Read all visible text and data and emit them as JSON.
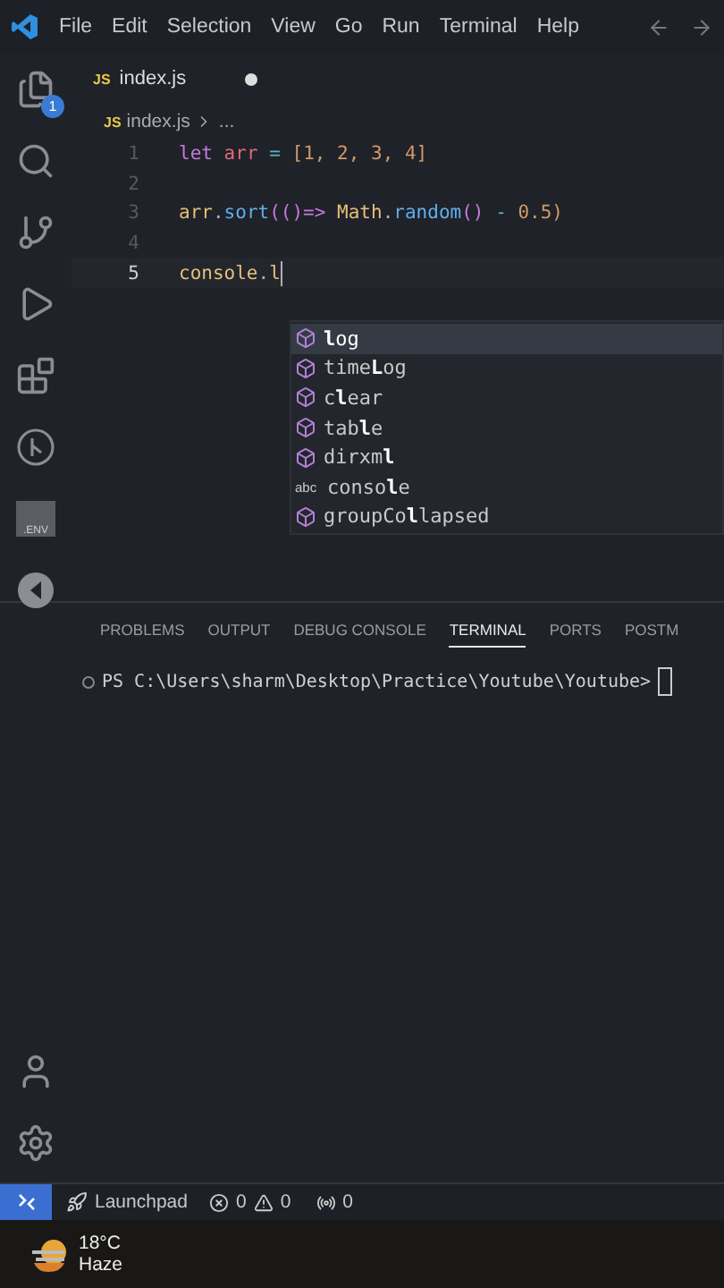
{
  "menu_bar": {
    "items": [
      "File",
      "Edit",
      "Selection",
      "View",
      "Go",
      "Run",
      "Terminal",
      "Help"
    ]
  },
  "activity_bar": {
    "explorer_badge": "1",
    "env_label": ".ENV"
  },
  "tab": {
    "label": "index.js",
    "file_type": "JS",
    "modified": true
  },
  "breadcrumb": {
    "file_type": "JS",
    "file": "index.js",
    "rest": "..."
  },
  "editor": {
    "lines": [
      {
        "number": "1",
        "current": false,
        "tokens": [
          {
            "kind": "keyword",
            "text": "let "
          },
          {
            "kind": "variable",
            "text": "arr "
          },
          {
            "kind": "operator",
            "text": "= "
          },
          {
            "kind": "number",
            "text": "[1, 2, 3, 4]"
          }
        ]
      },
      {
        "number": "2",
        "current": false
      },
      {
        "number": "3",
        "current": false,
        "tokens": [
          {
            "kind": "ident",
            "text": "arr"
          },
          {
            "kind": "punct",
            "text": "."
          },
          {
            "kind": "func",
            "text": "sort"
          },
          {
            "kind": "paren",
            "text": "(()=> "
          },
          {
            "kind": "ident",
            "text": "Math"
          },
          {
            "kind": "punct",
            "text": "."
          },
          {
            "kind": "func",
            "text": "random"
          },
          {
            "kind": "paren",
            "text": "() "
          },
          {
            "kind": "operator",
            "text": "- "
          },
          {
            "kind": "number",
            "text": "0.5)"
          }
        ]
      },
      {
        "number": "4",
        "current": false
      },
      {
        "number": "5",
        "current": true,
        "tokens": [
          {
            "kind": "ident",
            "text": "console"
          },
          {
            "kind": "punct",
            "text": "."
          },
          {
            "kind": "ident",
            "text": "l"
          }
        ]
      }
    ]
  },
  "suggestions": [
    {
      "kind": "method",
      "label": "**l**og",
      "selected": true
    },
    {
      "kind": "method",
      "label": "time**L**og",
      "selected": false
    },
    {
      "kind": "method",
      "label": "c**l**ear",
      "selected": false
    },
    {
      "kind": "method",
      "label": "tab**l**e",
      "selected": false
    },
    {
      "kind": "method",
      "label": "dirxm**l**",
      "selected": false
    },
    {
      "kind": "text",
      "icon_text": "abc",
      "label": "conso**l**e",
      "selected": false
    },
    {
      "kind": "method",
      "label": "groupCo**l**lapsed",
      "selected": false
    }
  ],
  "panel": {
    "tabs": [
      {
        "label": "PROBLEMS",
        "selected": false
      },
      {
        "label": "OUTPUT",
        "selected": false
      },
      {
        "label": "DEBUG CONSOLE",
        "selected": false
      },
      {
        "label": "TERMINAL",
        "selected": true
      },
      {
        "label": "PORTS",
        "selected": false
      },
      {
        "label": "POSTM",
        "selected": false
      }
    ],
    "terminal_prompt": "PS C:\\Users\\sharm\\Desktop\\Practice\\Youtube\\Youtube>"
  },
  "status_bar": {
    "launchpad": "Launchpad",
    "errors": "0",
    "warnings": "0",
    "ports": "0"
  },
  "taskbar": {
    "temperature": "18°C",
    "condition": "Haze"
  }
}
